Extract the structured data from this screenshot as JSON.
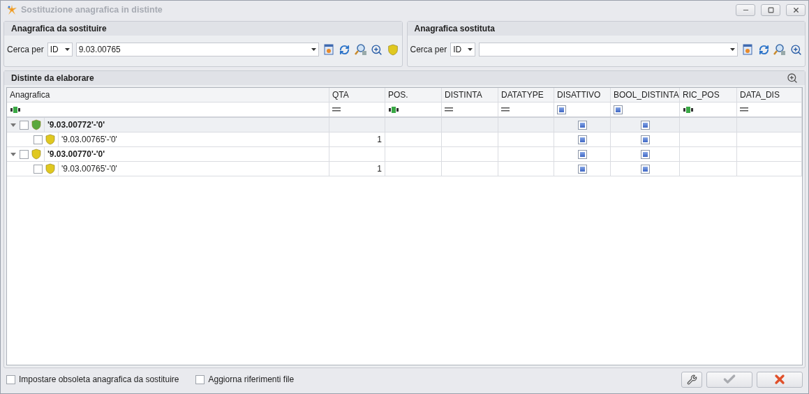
{
  "window": {
    "title": "Sostituzione anagrafica in distinte"
  },
  "search_panels": [
    {
      "title": "Anagrafica da sostituire",
      "search_label": "Cerca per",
      "search_by": "ID",
      "value": "9.03.00765",
      "tools": [
        {
          "kind": "card"
        },
        {
          "kind": "refresh"
        },
        {
          "kind": "find"
        },
        {
          "kind": "zoom"
        },
        {
          "kind": "shield"
        }
      ]
    },
    {
      "title": "Anagrafica sostituta",
      "search_label": "Cerca per",
      "search_by": "ID",
      "tools": [
        {
          "kind": "card"
        },
        {
          "kind": "refresh"
        },
        {
          "kind": "find"
        },
        {
          "kind": "zoom"
        }
      ]
    }
  ],
  "grid": {
    "title": "Distinte da elaborare",
    "columns": [
      {
        "label": "Anagrafica",
        "filter": {
          "kind": "text"
        }
      },
      {
        "label": "QTA",
        "filter": {
          "kind": "equals"
        }
      },
      {
        "label": "POS.",
        "filter": {
          "kind": "text"
        }
      },
      {
        "label": "DISTINTA",
        "filter": {
          "kind": "equals"
        }
      },
      {
        "label": "DATATYPE",
        "filter": {
          "kind": "equals"
        }
      },
      {
        "label": "DISATTIVO",
        "filter": {
          "kind": "check"
        }
      },
      {
        "label": "BOOL_DISTINTA",
        "filter": {
          "kind": "check"
        }
      },
      {
        "label": "RIC_POS",
        "filter": {
          "kind": "text"
        }
      },
      {
        "label": "DATA_DIS",
        "filter": {
          "kind": "equals"
        }
      }
    ],
    "rows": [
      {
        "label": "'9.03.00772'-'0'",
        "checked": false,
        "color": "#5aa83c",
        "selected": true,
        "expanded": true,
        "disattivo": {
          "kind": "indeterminate"
        },
        "bool_distinta": {
          "kind": "indeterminate"
        },
        "children": [
          {
            "label": "'9.03.00765'-'0'",
            "checked": false,
            "color": "#e0c820",
            "selected": false,
            "qta": "1",
            "disattivo": {
              "kind": "indeterminate"
            },
            "bool_distinta": {
              "kind": "indeterminate"
            }
          }
        ]
      },
      {
        "label": "'9.03.00770'-'0'",
        "checked": false,
        "color": "#e0c820",
        "selected": false,
        "expanded": true,
        "disattivo": {
          "kind": "indeterminate"
        },
        "bool_distinta": {
          "kind": "indeterminate"
        },
        "children": [
          {
            "label": "'9.03.00765'-'0'",
            "checked": false,
            "color": "#e0c820",
            "selected": false,
            "qta": "1",
            "disattivo": {
              "kind": "indeterminate"
            },
            "bool_distinta": {
              "kind": "indeterminate"
            }
          }
        ]
      }
    ]
  },
  "options": [
    {
      "label": "Impostare obsoleta anagrafica da sostituire",
      "checked": false
    },
    {
      "label": "Aggiorna riferimenti file",
      "checked": false
    }
  ],
  "buttons": [
    {
      "kind": "tools",
      "disabled": false
    },
    {
      "kind": "ok",
      "disabled": true
    },
    {
      "kind": "cancel",
      "disabled": false
    }
  ]
}
